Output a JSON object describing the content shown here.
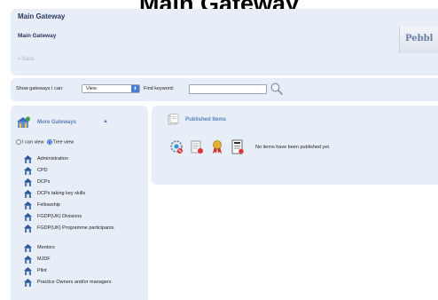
{
  "banner": {
    "title": "Main Gateway"
  },
  "header": {
    "title": "Main Gateway",
    "subtitle": "Main Gateway",
    "back_label": "« Back",
    "logo_text": "Pebbl"
  },
  "filter": {
    "show_label": "Show gateways I can:",
    "select_value": "View",
    "find_label": "Find keyword:",
    "keyword_value": ""
  },
  "left_panel": {
    "heading": "More Gateways",
    "view_options": [
      "I can view",
      "Tree view"
    ],
    "selected_view": "Tree view",
    "gateways": [
      "Administration",
      "CPD",
      "DCPs",
      "DCPs taking key skills",
      "Fellowship",
      "FGDP(UK) Divisions",
      "FGDP(UK) Programme participants",
      "Mentors",
      "MJDF",
      "Pilot",
      "Practice Owners and/or managers"
    ]
  },
  "published": {
    "title": "Published Items",
    "empty_message": "No items have been published yet.",
    "tool_icons": [
      "settings-refresh-icon",
      "document-edit-icon",
      "award-ribbon-icon",
      "report-document-icon"
    ]
  },
  "colors": {
    "panel_bg": "#e8eef8",
    "heading_blue": "#5a7fb8",
    "title_dark": "#2a3a5c"
  }
}
